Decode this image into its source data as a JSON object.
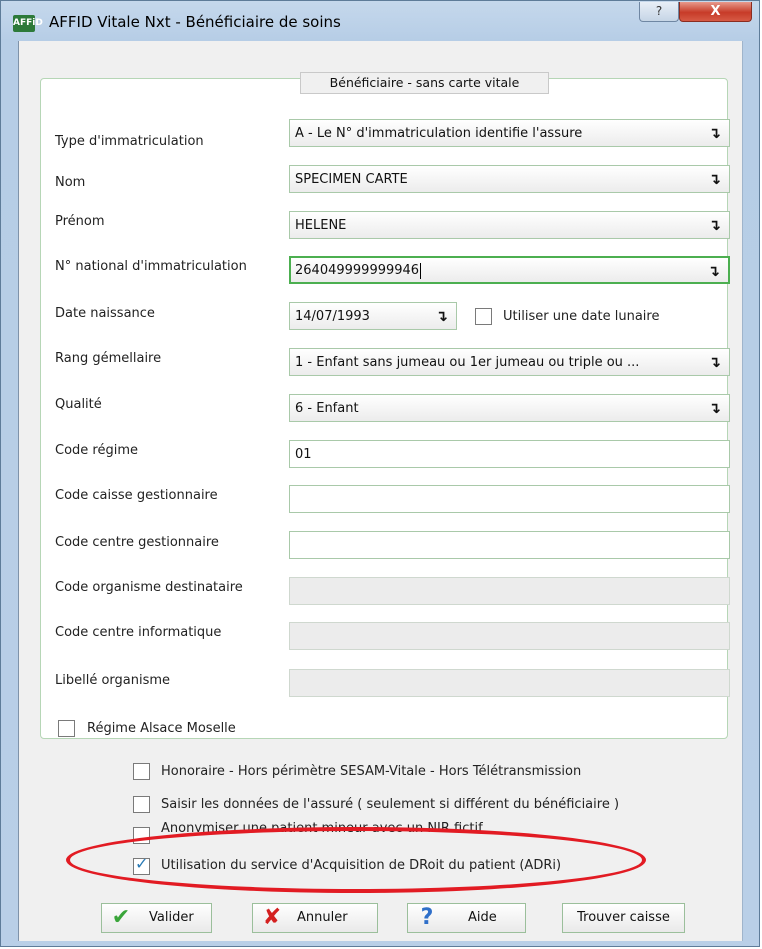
{
  "window": {
    "app_icon_text": "AFFiD",
    "title": "AFFID Vitale Nxt - Bénéficiaire de soins",
    "help_label": "?",
    "close_label": "X"
  },
  "group": {
    "title": "Bénéficiaire - sans carte vitale"
  },
  "fields": {
    "type_immatriculation": {
      "label": "Type d'immatriculation",
      "value": "A - Le N° d'immatriculation identifie l'assure"
    },
    "nom": {
      "label": "Nom",
      "value": "SPECIMEN CARTE"
    },
    "prenom": {
      "label": "Prénom",
      "value": "HELENE"
    },
    "nir": {
      "label": "N° national d'immatriculation",
      "value": "264049999999946"
    },
    "date_naissance": {
      "label": "Date naissance",
      "value": "14/07/1993"
    },
    "date_lunaire": {
      "label": "Utiliser une date lunaire"
    },
    "rang_gemellaire": {
      "label": "Rang gémellaire",
      "value": "1 - Enfant sans jumeau ou 1er jumeau ou triple ou ..."
    },
    "qualite": {
      "label": "Qualité",
      "value": "6 - Enfant"
    },
    "code_regime": {
      "label": "Code régime",
      "value": "01"
    },
    "code_caisse": {
      "label": "Code caisse gestionnaire",
      "value": ""
    },
    "code_centre": {
      "label": "Code centre gestionnaire",
      "value": ""
    },
    "code_organisme": {
      "label": "Code organisme destinataire",
      "value": ""
    },
    "code_centre_info": {
      "label": "Code centre informatique",
      "value": ""
    },
    "libelle_organisme": {
      "label": "Libellé organisme",
      "value": ""
    },
    "regime_alsace": {
      "label": "Régime Alsace Moselle"
    }
  },
  "options": {
    "honoraire": {
      "label": "Honoraire - Hors périmètre SESAM-Vitale - Hors Télétransmission",
      "checked": false
    },
    "saisir_assure": {
      "label": "Saisir les données de l'assuré ( seulement si différent du bénéficiaire )",
      "checked": false
    },
    "anonymiser": {
      "label": "Anonymiser une patient mineur avec un NIR fictif",
      "checked": false
    },
    "adri": {
      "label": "Utilisation du service d'Acquisition de DRoit du patient (ADRi)",
      "checked": true
    }
  },
  "buttons": {
    "valider": "Valider",
    "annuler": "Annuler",
    "aide": "Aide",
    "trouver_caisse": "Trouver caisse"
  },
  "icons": {
    "dropdown": "↴",
    "check": "✓",
    "valider_icon": "✔",
    "annuler_icon": "✘",
    "aide_icon": "?"
  },
  "colors": {
    "highlight_ellipse": "#e21b23",
    "valider": "#3aa53a",
    "annuler": "#d42020",
    "aide": "#2f6fc9"
  }
}
